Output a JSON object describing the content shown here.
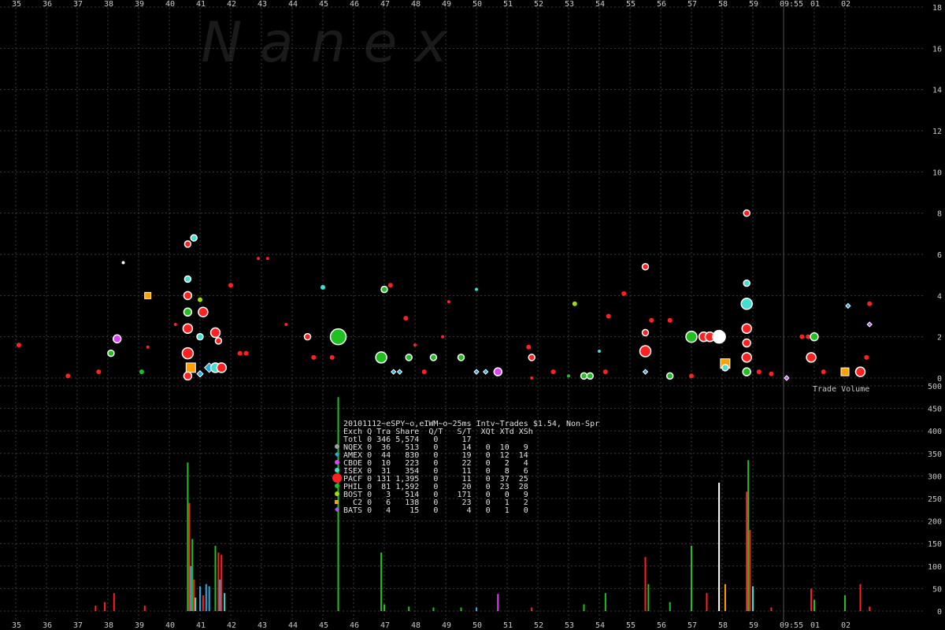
{
  "watermark": "N   a   n   e   x",
  "colors": {
    "NQEX": "#a0a0a0",
    "AMEX": "#29a9e0",
    "CBOE": "#e040fb",
    "ISEX": "#40e0d0",
    "PACF": "#ff2020",
    "PHIL": "#20c020",
    "BOST": "#a0e000",
    "C2": "#ffa000",
    "BATS": "#c050ff",
    "white": "#ffffff"
  },
  "chart_data": [
    {
      "type": "scatter",
      "title": "",
      "xlabel": "",
      "ylabel": "",
      "x_ticks": [
        "35",
        "36",
        "37",
        "38",
        "39",
        "40",
        "41",
        "42",
        "43",
        "44",
        "45",
        "46",
        "47",
        "48",
        "49",
        "50",
        "51",
        "52",
        "53",
        "54",
        "55",
        "56",
        "57",
        "58",
        "59",
        "09:55",
        "01",
        "02"
      ],
      "y_ticks": [
        0,
        2,
        4,
        6,
        8,
        10,
        12,
        14,
        16,
        18
      ],
      "ylim": [
        0,
        18
      ],
      "grid": true,
      "marker": "09:55",
      "points": [
        {
          "x": 35.1,
          "y": 1.6,
          "c": "PACF",
          "s": 3
        },
        {
          "x": 36.7,
          "y": 0.1,
          "c": "PACF",
          "s": 3
        },
        {
          "x": 37.7,
          "y": 0.3,
          "c": "PACF",
          "s": 3
        },
        {
          "x": 38.1,
          "y": 1.2,
          "c": "PHIL",
          "s": 4
        },
        {
          "x": 38.3,
          "y": 1.9,
          "c": "CBOE",
          "s": 5
        },
        {
          "x": 38.5,
          "y": 5.6,
          "c": "white",
          "s": 2
        },
        {
          "x": 39.1,
          "y": 0.3,
          "c": "PHIL",
          "s": 3
        },
        {
          "x": 39.3,
          "y": 4.0,
          "c": "C2",
          "s": 4
        },
        {
          "x": 39.3,
          "y": 1.5,
          "c": "PACF",
          "s": 2
        },
        {
          "x": 40.2,
          "y": 2.6,
          "c": "PACF",
          "s": 2
        },
        {
          "x": 40.6,
          "y": 6.5,
          "c": "PACF",
          "s": 4
        },
        {
          "x": 40.6,
          "y": 4.8,
          "c": "ISEX",
          "s": 4
        },
        {
          "x": 40.6,
          "y": 4.0,
          "c": "PACF",
          "s": 5
        },
        {
          "x": 40.6,
          "y": 3.2,
          "c": "PHIL",
          "s": 5
        },
        {
          "x": 40.6,
          "y": 2.4,
          "c": "PACF",
          "s": 6
        },
        {
          "x": 40.6,
          "y": 1.2,
          "c": "PACF",
          "s": 7
        },
        {
          "x": 40.7,
          "y": 0.5,
          "c": "C2",
          "s": 6
        },
        {
          "x": 40.6,
          "y": 0.1,
          "c": "PACF",
          "s": 5
        },
        {
          "x": 40.8,
          "y": 6.8,
          "c": "ISEX",
          "s": 4
        },
        {
          "x": 41.0,
          "y": 3.8,
          "c": "BOST",
          "s": 3
        },
        {
          "x": 41.1,
          "y": 3.2,
          "c": "PACF",
          "s": 6
        },
        {
          "x": 41.0,
          "y": 0.2,
          "c": "AMEX",
          "s": 4
        },
        {
          "x": 41.3,
          "y": 0.5,
          "c": "AMEX",
          "s": 6
        },
        {
          "x": 41.5,
          "y": 0.5,
          "c": "ISEX",
          "s": 6
        },
        {
          "x": 41.7,
          "y": 0.5,
          "c": "PACF",
          "s": 6
        },
        {
          "x": 41.5,
          "y": 2.2,
          "c": "PACF",
          "s": 6
        },
        {
          "x": 41.6,
          "y": 1.8,
          "c": "PACF",
          "s": 4
        },
        {
          "x": 41.0,
          "y": 2.0,
          "c": "ISEX",
          "s": 4
        },
        {
          "x": 42.0,
          "y": 4.5,
          "c": "PACF",
          "s": 3
        },
        {
          "x": 42.3,
          "y": 1.2,
          "c": "PACF",
          "s": 3
        },
        {
          "x": 42.5,
          "y": 1.2,
          "c": "PACF",
          "s": 3
        },
        {
          "x": 42.9,
          "y": 5.8,
          "c": "PACF",
          "s": 2
        },
        {
          "x": 43.2,
          "y": 5.8,
          "c": "PACF",
          "s": 2
        },
        {
          "x": 43.8,
          "y": 2.6,
          "c": "PACF",
          "s": 2
        },
        {
          "x": 44.5,
          "y": 2.0,
          "c": "PACF",
          "s": 4
        },
        {
          "x": 44.7,
          "y": 1.0,
          "c": "PACF",
          "s": 3
        },
        {
          "x": 45.0,
          "y": 4.4,
          "c": "ISEX",
          "s": 3
        },
        {
          "x": 45.3,
          "y": 1.0,
          "c": "PACF",
          "s": 3
        },
        {
          "x": 45.5,
          "y": 2.0,
          "c": "PHIL",
          "s": 10
        },
        {
          "x": 47.0,
          "y": 4.3,
          "c": "PHIL",
          "s": 4
        },
        {
          "x": 47.2,
          "y": 4.5,
          "c": "PACF",
          "s": 3
        },
        {
          "x": 46.9,
          "y": 1.0,
          "c": "PHIL",
          "s": 7
        },
        {
          "x": 47.3,
          "y": 0.3,
          "c": "AMEX",
          "s": 3
        },
        {
          "x": 47.5,
          "y": 0.3,
          "c": "AMEX",
          "s": 3
        },
        {
          "x": 47.7,
          "y": 2.9,
          "c": "PACF",
          "s": 3
        },
        {
          "x": 47.8,
          "y": 1.0,
          "c": "PHIL",
          "s": 4
        },
        {
          "x": 48.0,
          "y": 1.6,
          "c": "PACF",
          "s": 2
        },
        {
          "x": 48.3,
          "y": 0.3,
          "c": "PACF",
          "s": 3
        },
        {
          "x": 48.6,
          "y": 1.0,
          "c": "PHIL",
          "s": 4
        },
        {
          "x": 48.9,
          "y": 2.0,
          "c": "PACF",
          "s": 2
        },
        {
          "x": 49.1,
          "y": 3.7,
          "c": "PACF",
          "s": 2
        },
        {
          "x": 49.5,
          "y": 1.0,
          "c": "PHIL",
          "s": 4
        },
        {
          "x": 50.0,
          "y": 0.3,
          "c": "AMEX",
          "s": 3
        },
        {
          "x": 50.0,
          "y": 4.3,
          "c": "ISEX",
          "s": 2
        },
        {
          "x": 50.3,
          "y": 0.3,
          "c": "AMEX",
          "s": 3
        },
        {
          "x": 50.7,
          "y": 0.3,
          "c": "CBOE",
          "s": 5
        },
        {
          "x": 51.7,
          "y": 1.5,
          "c": "PACF",
          "s": 3
        },
        {
          "x": 51.8,
          "y": 1.0,
          "c": "PACF",
          "s": 4
        },
        {
          "x": 51.8,
          "y": 0.0,
          "c": "PACF",
          "s": 2
        },
        {
          "x": 52.5,
          "y": 0.3,
          "c": "PACF",
          "s": 3
        },
        {
          "x": 53.0,
          "y": 0.1,
          "c": "PHIL",
          "s": 2
        },
        {
          "x": 53.2,
          "y": 3.6,
          "c": "BOST",
          "s": 3
        },
        {
          "x": 53.5,
          "y": 0.1,
          "c": "PHIL",
          "s": 4
        },
        {
          "x": 53.7,
          "y": 0.1,
          "c": "PHIL",
          "s": 4
        },
        {
          "x": 54.0,
          "y": 1.3,
          "c": "ISEX",
          "s": 2
        },
        {
          "x": 54.2,
          "y": 0.3,
          "c": "PACF",
          "s": 3
        },
        {
          "x": 54.3,
          "y": 3.0,
          "c": "PACF",
          "s": 3
        },
        {
          "x": 54.8,
          "y": 4.1,
          "c": "PACF",
          "s": 3
        },
        {
          "x": 55.5,
          "y": 5.4,
          "c": "PACF",
          "s": 4
        },
        {
          "x": 55.5,
          "y": 2.2,
          "c": "PACF",
          "s": 4
        },
        {
          "x": 55.5,
          "y": 1.3,
          "c": "PACF",
          "s": 7
        },
        {
          "x": 55.5,
          "y": 0.3,
          "c": "AMEX",
          "s": 3
        },
        {
          "x": 55.7,
          "y": 2.8,
          "c": "PACF",
          "s": 3
        },
        {
          "x": 56.3,
          "y": 2.8,
          "c": "PACF",
          "s": 3
        },
        {
          "x": 56.3,
          "y": 0.1,
          "c": "PHIL",
          "s": 4
        },
        {
          "x": 57.0,
          "y": 2.0,
          "c": "PHIL",
          "s": 7
        },
        {
          "x": 57.4,
          "y": 2.0,
          "c": "PACF",
          "s": 6
        },
        {
          "x": 57.6,
          "y": 2.0,
          "c": "PACF",
          "s": 6
        },
        {
          "x": 57.9,
          "y": 2.0,
          "c": "white",
          "s": 8
        },
        {
          "x": 58.1,
          "y": 0.7,
          "c": "C2",
          "s": 6
        },
        {
          "x": 58.1,
          "y": 0.5,
          "c": "ISEX",
          "s": 4
        },
        {
          "x": 57.0,
          "y": 0.1,
          "c": "PACF",
          "s": 3
        },
        {
          "x": 58.8,
          "y": 8.0,
          "c": "PACF",
          "s": 4
        },
        {
          "x": 58.8,
          "y": 4.6,
          "c": "ISEX",
          "s": 4
        },
        {
          "x": 58.8,
          "y": 3.6,
          "c": "ISEX",
          "s": 7
        },
        {
          "x": 58.8,
          "y": 2.4,
          "c": "PACF",
          "s": 6
        },
        {
          "x": 58.8,
          "y": 1.7,
          "c": "PACF",
          "s": 5
        },
        {
          "x": 58.8,
          "y": 1.0,
          "c": "PACF",
          "s": 6
        },
        {
          "x": 58.8,
          "y": 0.3,
          "c": "PHIL",
          "s": 5
        },
        {
          "x": 59.2,
          "y": 0.3,
          "c": "PACF",
          "s": 3
        },
        {
          "x": 59.6,
          "y": 0.2,
          "c": "PACF",
          "s": 3
        },
        {
          "x": 60.1,
          "y": 0.0,
          "c": "BATS",
          "s": 3
        },
        {
          "x": 60.6,
          "y": 2.0,
          "c": "PACF",
          "s": 3
        },
        {
          "x": 60.8,
          "y": 2.0,
          "c": "PACF",
          "s": 3
        },
        {
          "x": 60.9,
          "y": 1.0,
          "c": "PACF",
          "s": 6
        },
        {
          "x": 61.0,
          "y": 2.0,
          "c": "PHIL",
          "s": 5
        },
        {
          "x": 61.3,
          "y": 0.3,
          "c": "PACF",
          "s": 3
        },
        {
          "x": 62.0,
          "y": 0.3,
          "c": "C2",
          "s": 5
        },
        {
          "x": 62.1,
          "y": 3.5,
          "c": "AMEX",
          "s": 3
        },
        {
          "x": 62.5,
          "y": 0.3,
          "c": "PACF",
          "s": 6
        },
        {
          "x": 62.7,
          "y": 1.0,
          "c": "PACF",
          "s": 3
        },
        {
          "x": 62.8,
          "y": 3.6,
          "c": "PACF",
          "s": 3
        },
        {
          "x": 62.8,
          "y": 2.6,
          "c": "BATS",
          "s": 3
        }
      ]
    },
    {
      "type": "bar",
      "title": "",
      "label": "Trade Volume",
      "y_ticks": [
        0,
        50,
        100,
        150,
        200,
        250,
        300,
        350,
        400,
        450,
        500
      ],
      "ylim": [
        0,
        500
      ],
      "bars": [
        {
          "x": 37.6,
          "v": 12,
          "c": "PACF"
        },
        {
          "x": 37.9,
          "v": 20,
          "c": "PACF"
        },
        {
          "x": 38.2,
          "v": 40,
          "c": "PACF"
        },
        {
          "x": 39.2,
          "v": 12,
          "c": "PACF"
        },
        {
          "x": 40.6,
          "v": 330,
          "c": "PHIL"
        },
        {
          "x": 40.65,
          "v": 240,
          "c": "PACF"
        },
        {
          "x": 40.7,
          "v": 100,
          "c": "AMEX"
        },
        {
          "x": 40.75,
          "v": 160,
          "c": "PHIL"
        },
        {
          "x": 40.8,
          "v": 70,
          "c": "PACF"
        },
        {
          "x": 40.85,
          "v": 30,
          "c": "ISEX"
        },
        {
          "x": 41.0,
          "v": 55,
          "c": "AMEX"
        },
        {
          "x": 41.1,
          "v": 35,
          "c": "PACF"
        },
        {
          "x": 41.2,
          "v": 60,
          "c": "AMEX"
        },
        {
          "x": 41.3,
          "v": 55,
          "c": "AMEX"
        },
        {
          "x": 41.5,
          "v": 145,
          "c": "PHIL"
        },
        {
          "x": 41.6,
          "v": 130,
          "c": "PACF"
        },
        {
          "x": 41.65,
          "v": 70,
          "c": "AMEX"
        },
        {
          "x": 41.7,
          "v": 125,
          "c": "PACF"
        },
        {
          "x": 41.8,
          "v": 40,
          "c": "ISEX"
        },
        {
          "x": 45.5,
          "v": 475,
          "c": "PHIL"
        },
        {
          "x": 46.9,
          "v": 130,
          "c": "PHIL"
        },
        {
          "x": 47.0,
          "v": 15,
          "c": "PHIL"
        },
        {
          "x": 47.8,
          "v": 10,
          "c": "PHIL"
        },
        {
          "x": 48.6,
          "v": 8,
          "c": "PHIL"
        },
        {
          "x": 49.5,
          "v": 8,
          "c": "PHIL"
        },
        {
          "x": 50.0,
          "v": 8,
          "c": "AMEX"
        },
        {
          "x": 50.7,
          "v": 38,
          "c": "CBOE"
        },
        {
          "x": 51.8,
          "v": 8,
          "c": "PACF"
        },
        {
          "x": 53.5,
          "v": 15,
          "c": "PHIL"
        },
        {
          "x": 54.2,
          "v": 40,
          "c": "PHIL"
        },
        {
          "x": 55.5,
          "v": 120,
          "c": "PACF"
        },
        {
          "x": 55.6,
          "v": 60,
          "c": "PHIL"
        },
        {
          "x": 56.3,
          "v": 20,
          "c": "PHIL"
        },
        {
          "x": 57.0,
          "v": 145,
          "c": "PHIL"
        },
        {
          "x": 57.5,
          "v": 40,
          "c": "PACF"
        },
        {
          "x": 57.9,
          "v": 285,
          "c": "white"
        },
        {
          "x": 58.1,
          "v": 60,
          "c": "C2"
        },
        {
          "x": 58.8,
          "v": 265,
          "c": "PACF"
        },
        {
          "x": 58.85,
          "v": 335,
          "c": "PHIL"
        },
        {
          "x": 58.9,
          "v": 180,
          "c": "PACF"
        },
        {
          "x": 59.0,
          "v": 55,
          "c": "ISEX"
        },
        {
          "x": 59.6,
          "v": 8,
          "c": "PACF"
        },
        {
          "x": 60.9,
          "v": 50,
          "c": "PACF"
        },
        {
          "x": 61.0,
          "v": 25,
          "c": "PHIL"
        },
        {
          "x": 62.0,
          "v": 35,
          "c": "PHIL"
        },
        {
          "x": 62.5,
          "v": 60,
          "c": "PACF"
        },
        {
          "x": 62.8,
          "v": 10,
          "c": "PACF"
        }
      ]
    }
  ],
  "info_table": {
    "header": "20101112~eSPY~o,eIWM~o~25ms Intv~Trades $1.54, Non-Spr",
    "columns": "Exch Q Tra Share  Q/T   S/T  XQt XTd XSh",
    "total": "Totl 0 346 5,574   0     17",
    "rows": [
      {
        "key": "NQEX",
        "text": "NQEX 0  36   513   0     14   0  10   9"
      },
      {
        "key": "AMEX",
        "text": "AMEX 0  44   830   0     19   0  12  14"
      },
      {
        "key": "CBOE",
        "text": "CBOE 0  10   223   0     22   0   2   4"
      },
      {
        "key": "ISEX",
        "text": "ISEX 0  31   354   0     11   0   8   6"
      },
      {
        "key": "PACF",
        "text": "PACF 0 131 1,395   0     11   0  37  25"
      },
      {
        "key": "PHIL",
        "text": "PHIL 0  81 1,592   0     20   0  23  28"
      },
      {
        "key": "BOST",
        "text": "BOST 0   3   514   0    171   0   0   9"
      },
      {
        "key": "C2",
        "text": "  C2 0   6   138   0     23   0   1   2"
      },
      {
        "key": "BATS",
        "text": "BATS 0   4    15   0      4   0   1   0"
      }
    ]
  }
}
